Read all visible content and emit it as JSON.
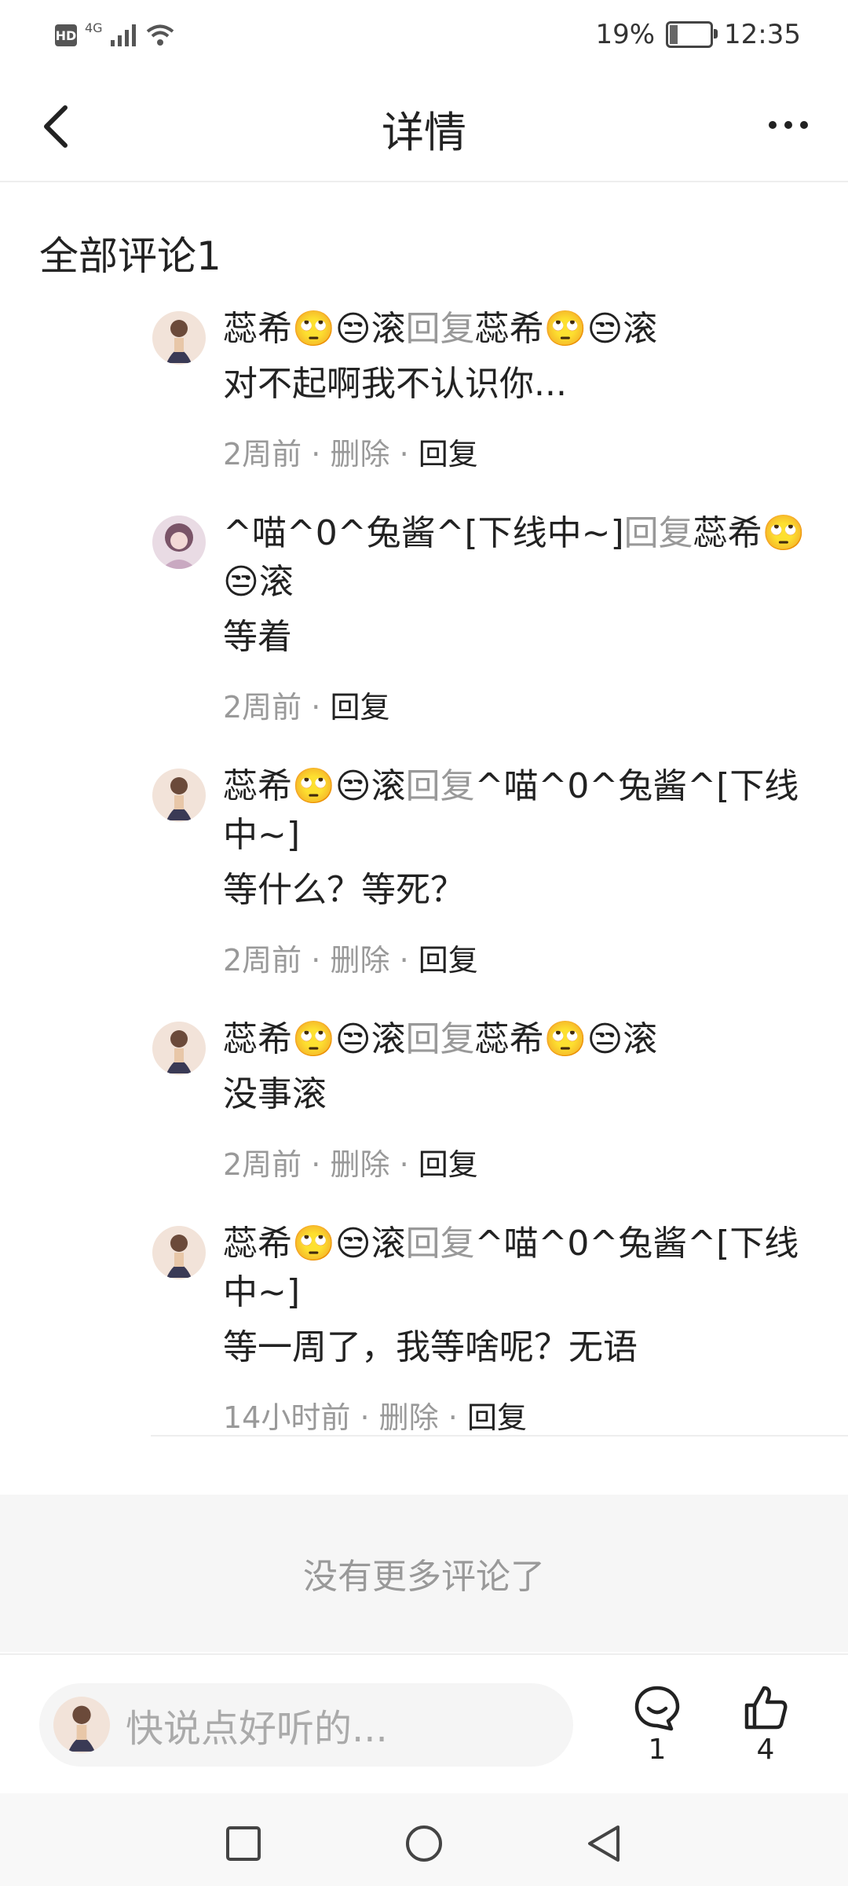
{
  "status": {
    "network": "4G",
    "battery": "19%",
    "battery_level": 0.19,
    "time": "12:35"
  },
  "header": {
    "title": "详情"
  },
  "section": {
    "title": "全部评论1"
  },
  "comments": [
    {
      "user": "蕊希🙄😒滚",
      "reply_word": "回复",
      "target": "蕊希🙄😒滚",
      "text": "对不起啊我不认识你...",
      "time": "2周前",
      "delete": "删除",
      "reply": "回复"
    },
    {
      "user": "^喵^0^兔酱^[下线中~]",
      "reply_word": "回复",
      "target": "蕊希🙄😒滚",
      "text": "等着",
      "time": "2周前",
      "reply": "回复"
    },
    {
      "user": "蕊希🙄😒滚",
      "reply_word": "回复",
      "target": "^喵^0^兔酱^[下线中~]",
      "text": "等什么？等死？",
      "time": "2周前",
      "delete": "删除",
      "reply": "回复"
    },
    {
      "user": "蕊希🙄😒滚",
      "reply_word": "回复",
      "target": "蕊希🙄😒滚",
      "text": "没事滚",
      "time": "2周前",
      "delete": "删除",
      "reply": "回复"
    },
    {
      "user": "蕊希🙄😒滚",
      "reply_word": "回复",
      "target": "^喵^0^兔酱^[下线中~]",
      "text": "等一周了，我等啥呢？无语",
      "time": "14小时前",
      "delete": "删除",
      "reply": "回复"
    }
  ],
  "no_more": "没有更多评论了",
  "input": {
    "placeholder": "快说点好听的..."
  },
  "actions": {
    "comment_count": "1",
    "like_count": "4"
  },
  "meta_separator": "·"
}
